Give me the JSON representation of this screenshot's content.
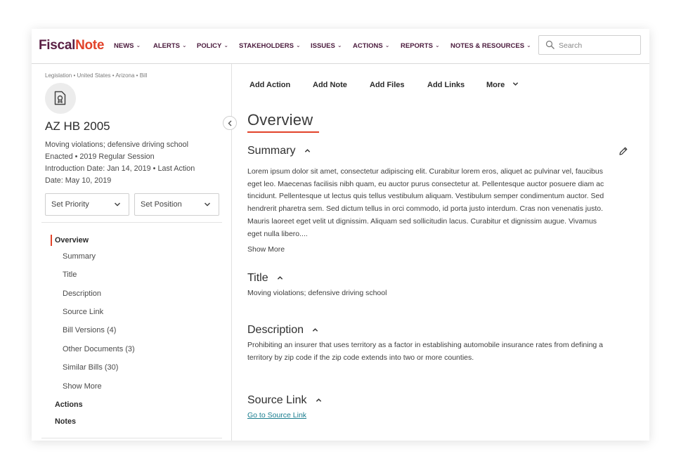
{
  "brand": {
    "part1": "Fiscal",
    "part2": "Note",
    "color1": "#5a1f44",
    "color2": "#e2432a"
  },
  "nav": [
    {
      "label": "NEWS"
    },
    {
      "label": "ALERTS"
    },
    {
      "label": "POLICY"
    },
    {
      "label": "STAKEHOLDERS"
    },
    {
      "label": "ISSUES"
    },
    {
      "label": "ACTIONS"
    },
    {
      "label": "REPORTS"
    },
    {
      "label": "NOTES & RESOURCES"
    }
  ],
  "search": {
    "placeholder": "Search",
    "icon": "search-icon"
  },
  "sidebar": {
    "breadcrumb": "Legislation • United States • Arizona • Bill",
    "bill_id": "AZ HB 2005",
    "short_title": "Moving violations; defensive driving school",
    "status": "Enacted • 2019 Regular Session",
    "dates_line1": "Introduction Date: Jan 14, 2019 • Last Action",
    "dates_line2": "Date: May 10, 2019",
    "priority_label": "Set Priority",
    "position_label": "Set Position",
    "toc": [
      {
        "label": "Overview"
      },
      {
        "label": "Summary"
      },
      {
        "label": "Title"
      },
      {
        "label": "Description"
      },
      {
        "label": "Source Link"
      },
      {
        "label": "Bill Versions (4)"
      },
      {
        "label": "Other Documents (3)"
      },
      {
        "label": "Similar Bills (30)"
      },
      {
        "label": "Show More"
      },
      {
        "label": "Actions"
      },
      {
        "label": "Notes"
      }
    ]
  },
  "actions": {
    "add_action": "Add Action",
    "add_note": "Add Note",
    "add_files": "Add Files",
    "add_links": "Add Links",
    "more": "More"
  },
  "main": {
    "heading": "Overview",
    "summary": {
      "title": "Summary",
      "lines": [
        "Lorem ipsum dolor sit amet, consectetur adipiscing elit. Curabitur lorem eros, aliquet ac pulvinar vel, faucibus",
        "eget leo. Maecenas facilisis nibh quam, eu auctor purus consectetur at. Pellentesque auctor posuere diam ac",
        "tincidunt. Pellentesque ut lectus quis tellus vestibulum aliquam. Vestibulum semper condimentum auctor. Sed",
        "hendrerit pharetra sem. Sed dictum tellus in orci commodo, id porta justo interdum. Cras non venenatis justo.",
        "Mauris laoreet eget velit ut dignissim. Aliquam sed sollicitudin lacus. Curabitur et dignissim augue. Vivamus",
        "eget nulla libero...."
      ],
      "show_more": "Show More"
    },
    "title_section": {
      "title": "Title",
      "text": "Moving violations; defensive driving school"
    },
    "description": {
      "title": "Description",
      "lines": [
        "Prohibiting an insurer that uses territory as a factor in establishing automobile insurance rates from defining a",
        "territory by zip code if the zip code extends into two or more counties."
      ]
    },
    "source_link": {
      "title": "Source Link",
      "link_text": "Go to Source Link"
    }
  },
  "colors": {
    "accent": "#e2432a",
    "link": "#1a7d8f"
  }
}
